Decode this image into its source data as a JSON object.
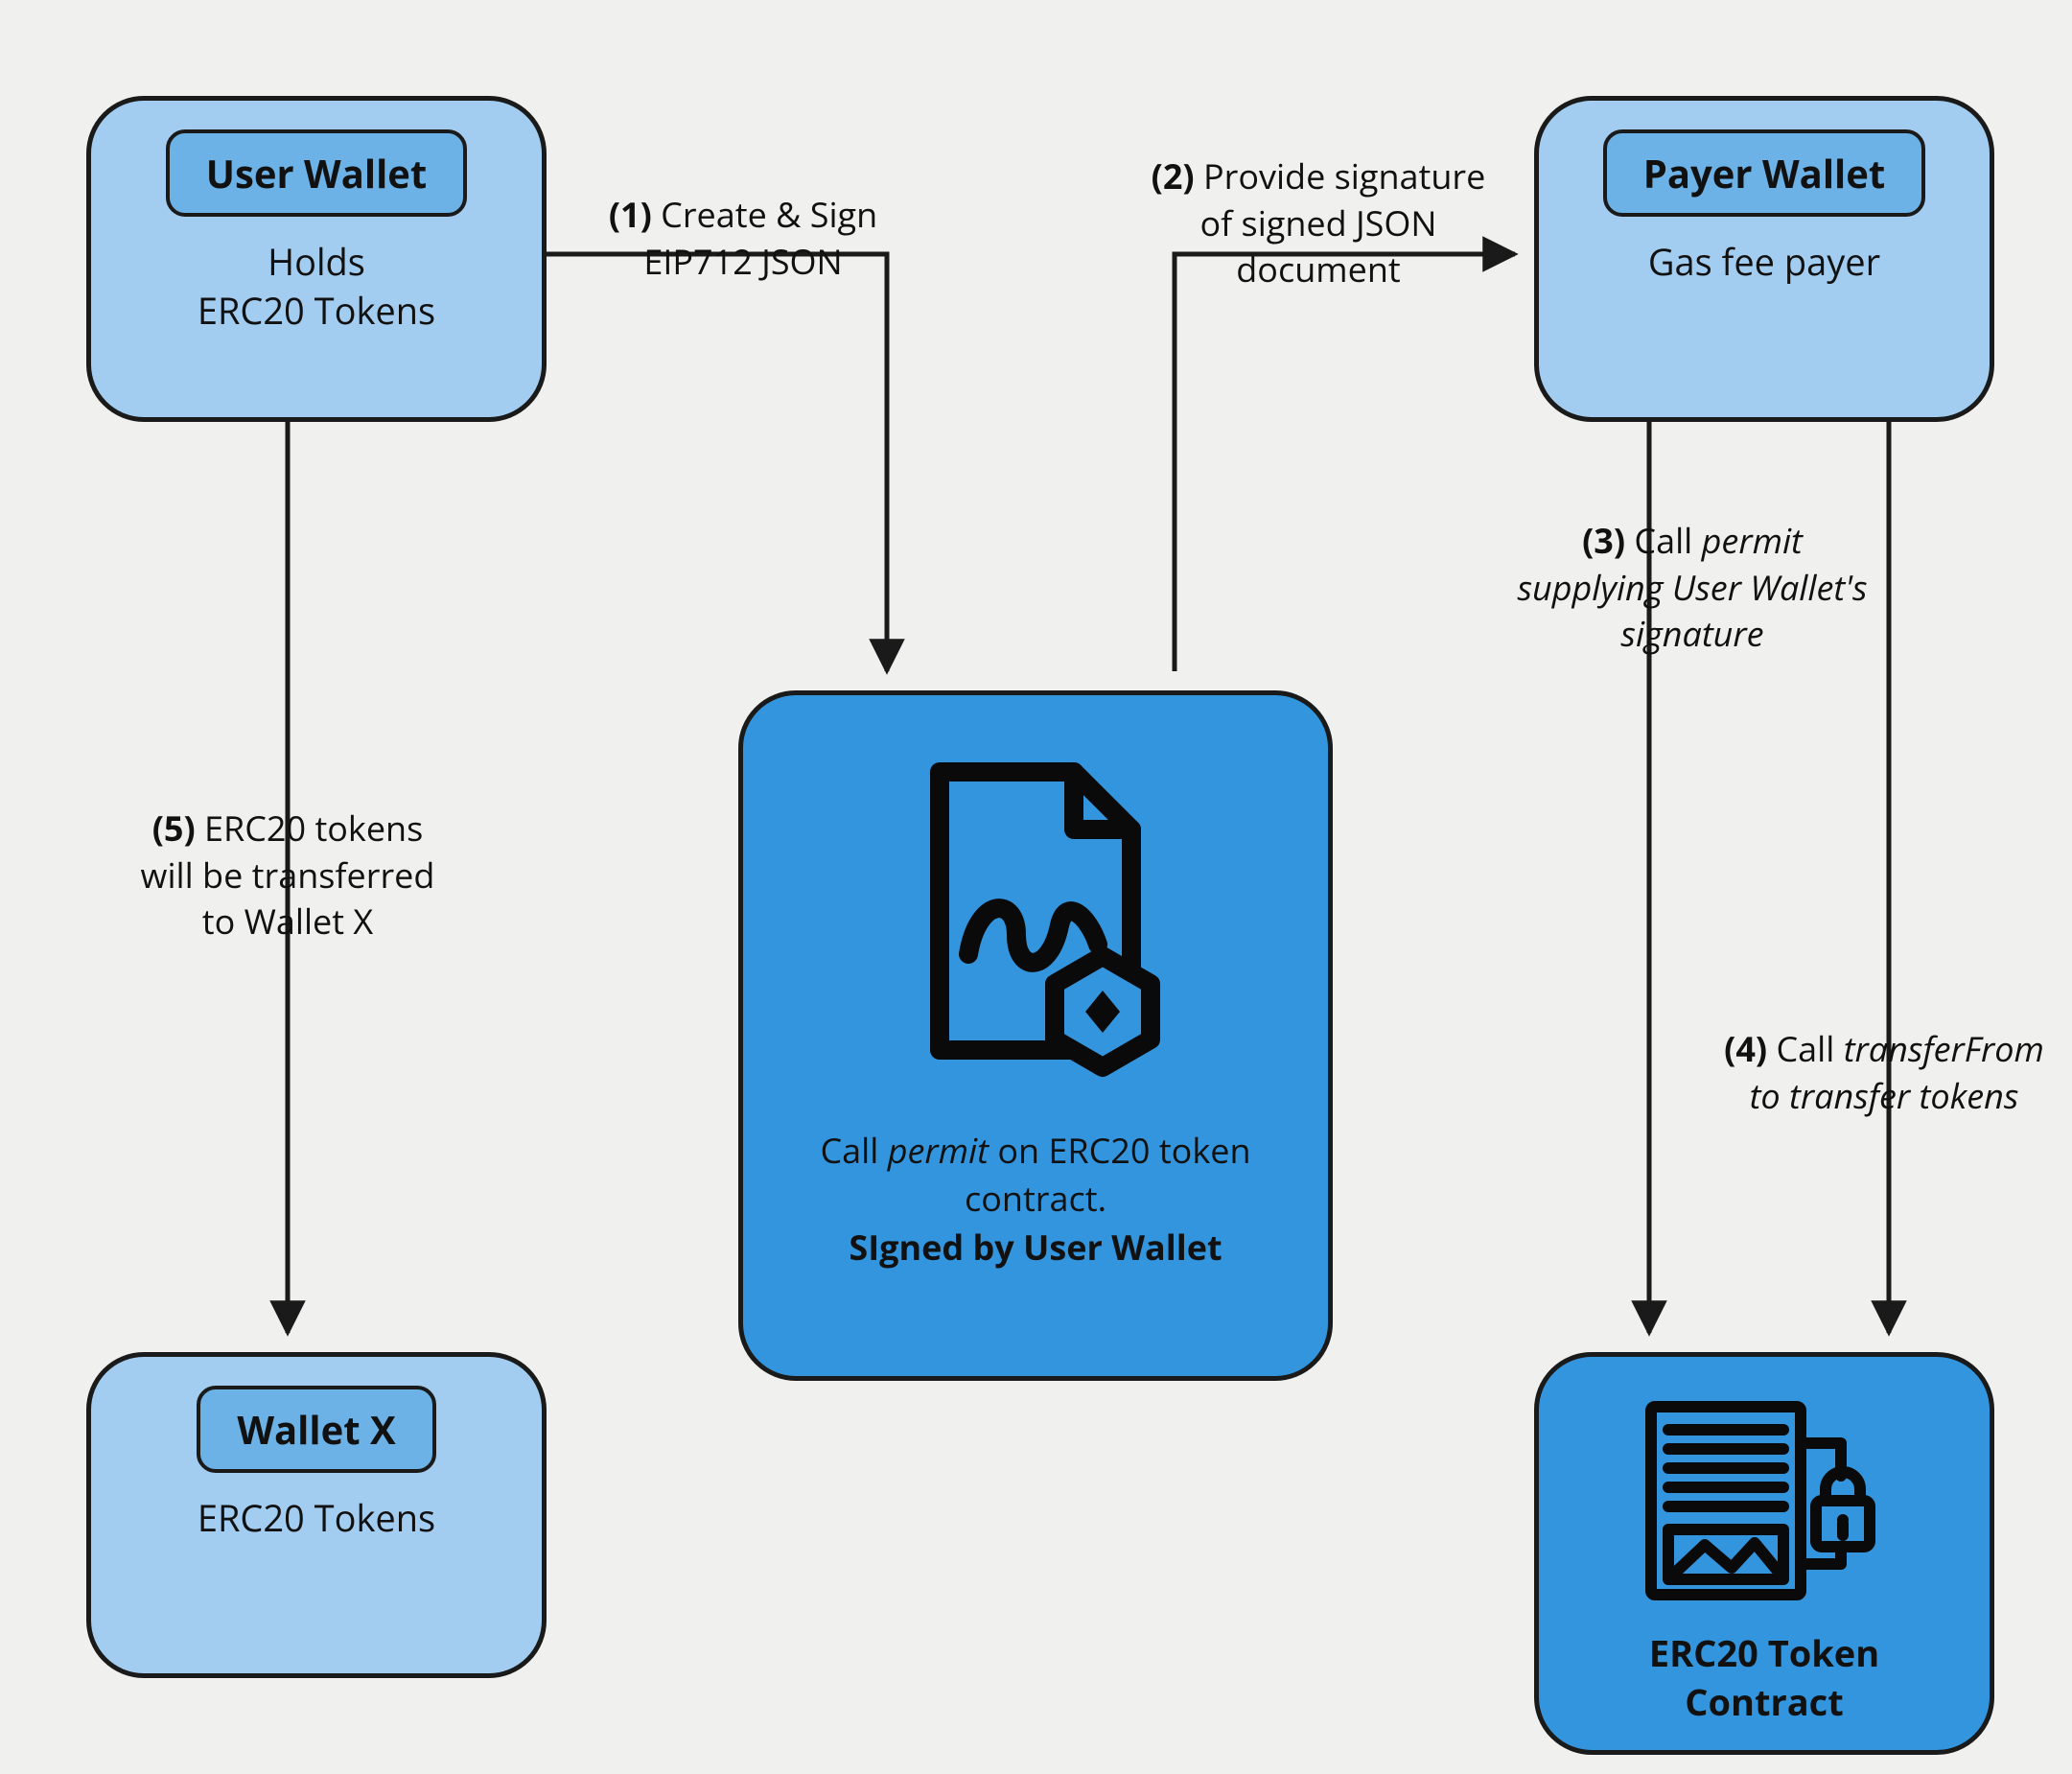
{
  "nodes": {
    "user_wallet": {
      "title": "User Wallet",
      "subtitle": "Holds\nERC20 Tokens"
    },
    "payer_wallet": {
      "title": "Payer Wallet",
      "subtitle": "Gas fee payer"
    },
    "wallet_x": {
      "title": "Wallet X",
      "subtitle": "ERC20 Tokens"
    },
    "signed_doc": {
      "caption_pre": "Call ",
      "caption_ital": "permit",
      "caption_post": " on ERC20 token contract.",
      "caption_bold": "SIgned by User Wallet"
    },
    "erc20_contract": {
      "label": "ERC20 Token Contract"
    }
  },
  "steps": {
    "s1": {
      "num": "(1)",
      "text": " Create & Sign EIP712 JSON"
    },
    "s2": {
      "num": "(2)",
      "text_a": " Provide signature of signed JSON document"
    },
    "s3": {
      "num": "(3)",
      "text_a": " Call ",
      "ital": "permit supplying User Wallet's signature"
    },
    "s4": {
      "num": "(4)",
      "text_a": " Call ",
      "ital": "transferFrom to transfer tokens"
    },
    "s5": {
      "num": "(5)",
      "text_a": " ERC20 tokens will be transferred to Wallet X"
    }
  }
}
